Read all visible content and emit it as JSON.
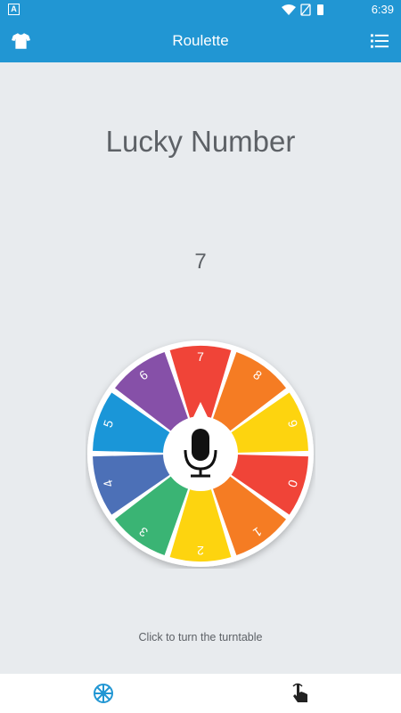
{
  "status_bar": {
    "time": "6:39",
    "notification_letter": "A"
  },
  "app_bar": {
    "title": "Roulette",
    "left_icon": "tshirt-icon",
    "right_icon": "list-icon"
  },
  "main": {
    "heading": "Lucky Number",
    "result": "7",
    "hint": "Click to turn the turntable"
  },
  "wheel": {
    "segments": [
      {
        "label": "7",
        "color": "#f04438"
      },
      {
        "label": "8",
        "color": "#f57c23"
      },
      {
        "label": "9",
        "color": "#fdd40f"
      },
      {
        "label": "0",
        "color": "#f04438"
      },
      {
        "label": "1",
        "color": "#f57c23"
      },
      {
        "label": "2",
        "color": "#fdd40f"
      },
      {
        "label": "3",
        "color": "#3ab474"
      },
      {
        "label": "4",
        "color": "#4c70b7"
      },
      {
        "label": "5",
        "color": "#1a96d8"
      },
      {
        "label": "6",
        "color": "#8650a8"
      }
    ],
    "center_icon": "microphone-icon",
    "pointer_color": "#ffffff"
  },
  "bottom_nav": {
    "items": [
      {
        "icon": "wheel-icon",
        "color": "#2196d3"
      },
      {
        "icon": "hand-pointer-icon",
        "color": "#222222"
      }
    ]
  },
  "colors": {
    "primary": "#2196d3",
    "background": "#e8ebee",
    "text": "#5d6166"
  }
}
